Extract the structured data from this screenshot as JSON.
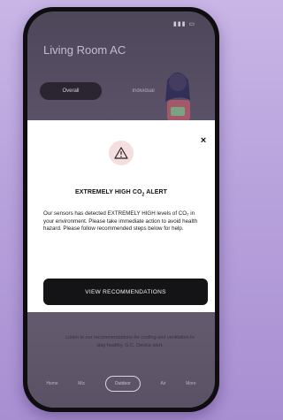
{
  "app": {
    "title": "Living Room AC",
    "tabs": [
      "Overall",
      "Individual"
    ]
  },
  "modal": {
    "title_pre": "EXTREMELY HIGH CO",
    "title_sub": "2",
    "title_post": " ALERT",
    "body": "Our sensors has detected EXTREMELY HIGH levels of CO₂ in your environment. Please take immediate action to avoid health hazard. Please follow recommended steps below for help.",
    "button_label": "VIEW RECOMMENDATIONS"
  },
  "background_note": "Listen to our recommendations for cooling and ventilation to stay healthy. G.C. Device alert.",
  "nav": [
    "Home",
    "Mic",
    "Outdoor",
    "Air",
    "More"
  ],
  "colors": {
    "modal_bg": "#ffffff",
    "button_bg": "#141416",
    "warning_circle": "#f5dede",
    "page_bg": "#b8a2dc"
  }
}
